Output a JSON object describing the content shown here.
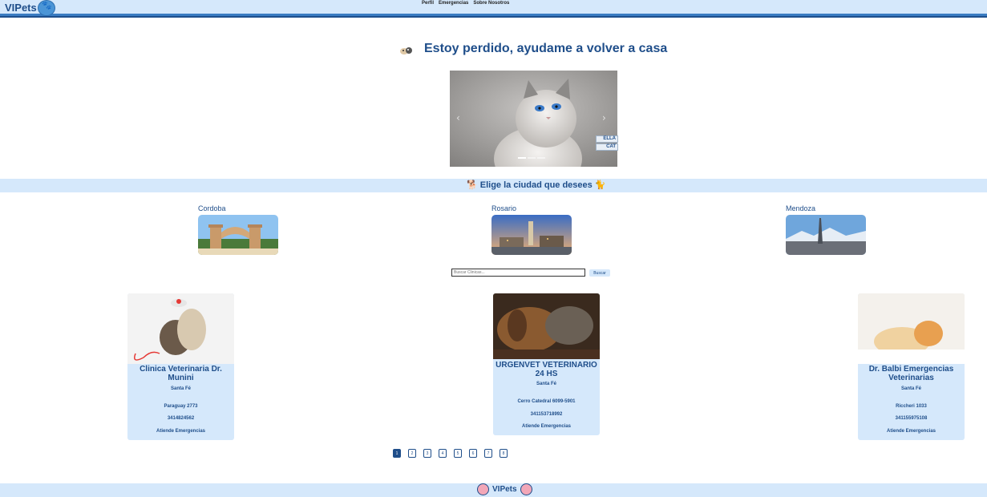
{
  "header": {
    "logo": "VIPets",
    "nav": [
      "Perfil",
      "Emergencias",
      "Sobre Nosotros"
    ]
  },
  "lost": {
    "title": "Estoy perdido, ayudame a volver a casa",
    "tags": [
      "ELLA",
      "CAT"
    ]
  },
  "cities": {
    "heading": "Elige la ciudad que desees",
    "items": [
      "Cordoba",
      "Rosario",
      "Mendoza"
    ]
  },
  "search": {
    "placeholder": "Buscar Clinicas...",
    "button": "Buscar"
  },
  "clinics": [
    {
      "name": "Clinica Veterinaria Dr. Munini",
      "city": "Santa Fé",
      "address": "Paraguay 2773",
      "phone": "3414824562",
      "note": "Atiende Emergencias"
    },
    {
      "name": "URGENVET VETERINARIO 24 HS",
      "city": "Santa Fé",
      "address": "Cerro Catedral 6099-5901",
      "phone": "341153718992",
      "note": "Atiende Emergencias"
    },
    {
      "name": "Dr. Balbi Emergencias Veterinarias",
      "city": "Santa Fé",
      "address": "Riccheri 1033",
      "phone": "341155975108",
      "note": "Atiende Emergencias"
    }
  ],
  "pagination": [
    "1",
    "2",
    "3",
    "4",
    "5",
    "6",
    "7",
    "8"
  ],
  "footer": {
    "text": "VIPets"
  },
  "colors": {
    "primary": "#1f4e8a",
    "light": "#d5e8fb"
  }
}
